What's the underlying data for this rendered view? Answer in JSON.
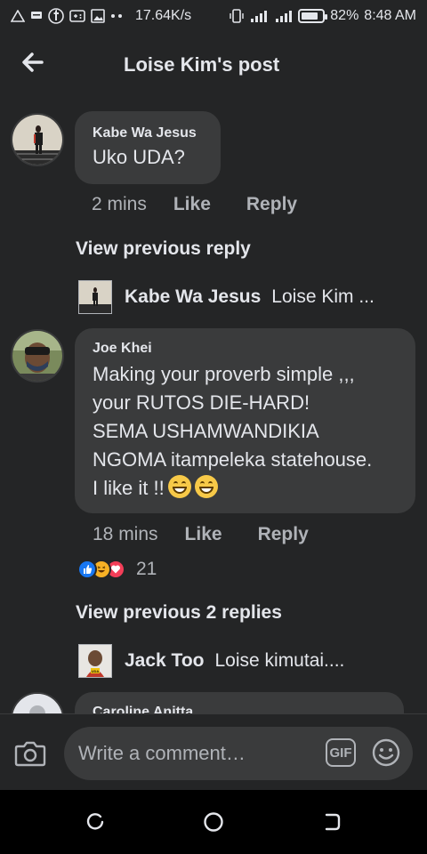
{
  "status_bar": {
    "speed": "17.64K/s",
    "battery_percent": "82%",
    "battery_level": 0.82,
    "time": "8:48 AM"
  },
  "header": {
    "title": "Loise Kim's post",
    "back_icon": "arrow-left-icon"
  },
  "comments": [
    {
      "author": "Kabe Wa Jesus",
      "text": "Uko UDA?",
      "time": "2 mins",
      "like_label": "Like",
      "reply_label": "Reply"
    },
    {
      "author": "Joe Khei",
      "lines": [
        "Making your proverb simple ,,,",
        "your RUTOS DIE-HARD!",
        "SEMA USHAMWANDIKIA",
        "NGOMA itampeleka statehouse."
      ],
      "last_line": "I like it !!",
      "time": "18 mins",
      "like_label": "Like",
      "reply_label": "Reply",
      "reaction_count": "21"
    },
    {
      "author": "Caroline Anitta"
    }
  ],
  "view_previous_reply": "View previous reply",
  "view_previous_replies": "View previous 2 replies",
  "reply_previews": [
    {
      "author": "Kabe Wa Jesus",
      "text": "Loise Kim ..."
    },
    {
      "author": "Jack Too",
      "text": "Loise kimutai...."
    }
  ],
  "compose": {
    "placeholder": "Write a comment…",
    "gif_label": "GIF"
  },
  "colors": {
    "background": "#242526",
    "bubble": "#3a3b3c",
    "text": "#e4e6eb",
    "secondary_text": "#b0b3b8",
    "like_reaction": "#1877f2",
    "love_reaction": "#f33e58",
    "haha_reaction": "#f7b125"
  }
}
